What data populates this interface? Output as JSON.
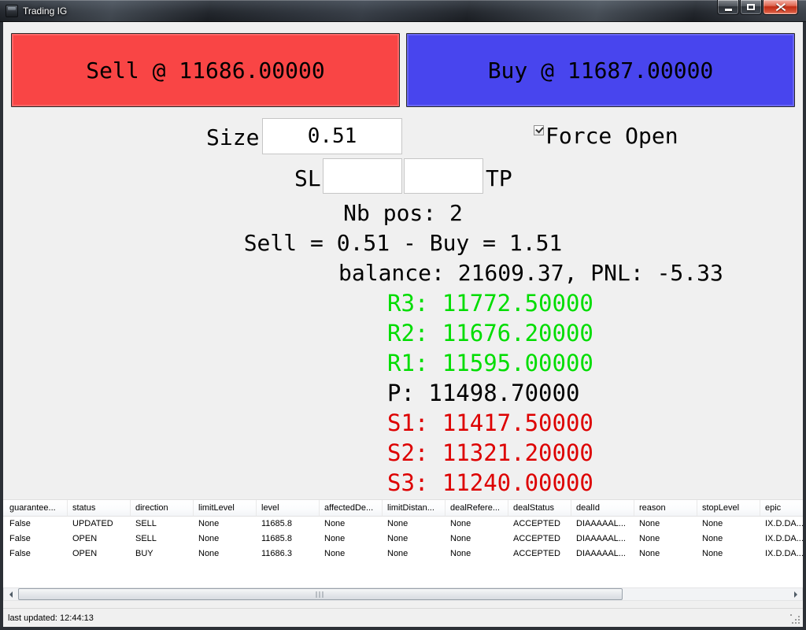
{
  "window": {
    "title": "Trading IG"
  },
  "colors": {
    "sell_button": "#f94545",
    "buy_button": "#4845ee",
    "resistance_text": "#00dd00",
    "pivot_text": "#000000",
    "support_text": "#dd0000"
  },
  "trade": {
    "sell_label": "Sell @ 11686.00000",
    "buy_label": "Buy @ 11687.00000"
  },
  "form": {
    "size_label": "Size",
    "size_value": "0.51",
    "force_open_label": "Force Open",
    "force_open_checked": true,
    "sl_label": "SL",
    "sl_value": "",
    "tp_label": "TP",
    "tp_value": ""
  },
  "info": {
    "nb_pos": "Nb pos: 2",
    "exposure": "Sell = 0.51 - Buy = 1.51",
    "balance": "balance: 21609.37, PNL: -5.33",
    "levels": [
      {
        "label": "R3: 11772.50000",
        "color": "#00dd00"
      },
      {
        "label": "R2: 11676.20000",
        "color": "#00dd00"
      },
      {
        "label": "R1: 11595.00000",
        "color": "#00dd00"
      },
      {
        "label": "P: 11498.70000",
        "color": "#000000"
      },
      {
        "label": "S1: 11417.50000",
        "color": "#dd0000"
      },
      {
        "label": "S2: 11321.20000",
        "color": "#dd0000"
      },
      {
        "label": "S3: 11240.00000",
        "color": "#dd0000"
      }
    ]
  },
  "positions_table": {
    "columns": [
      "guarantee...",
      "status",
      "direction",
      "limitLevel",
      "level",
      "affectedDe...",
      "limitDistan...",
      "dealRefere...",
      "dealStatus",
      "dealId",
      "reason",
      "stopLevel",
      "epic"
    ],
    "rows": [
      [
        "False",
        "UPDATED",
        "SELL",
        "None",
        "11685.8",
        "None",
        "None",
        "None",
        "ACCEPTED",
        "DIAAAAAL...",
        "None",
        "None",
        "IX.D.DA..."
      ],
      [
        "False",
        "OPEN",
        "SELL",
        "None",
        "11685.8",
        "None",
        "None",
        "None",
        "ACCEPTED",
        "DIAAAAAL...",
        "None",
        "None",
        "IX.D.DA..."
      ],
      [
        "False",
        "OPEN",
        "BUY",
        "None",
        "11686.3",
        "None",
        "None",
        "None",
        "ACCEPTED",
        "DIAAAAAL...",
        "None",
        "None",
        "IX.D.DA..."
      ]
    ]
  },
  "statusbar": {
    "text": "last updated: 12:44:13"
  }
}
